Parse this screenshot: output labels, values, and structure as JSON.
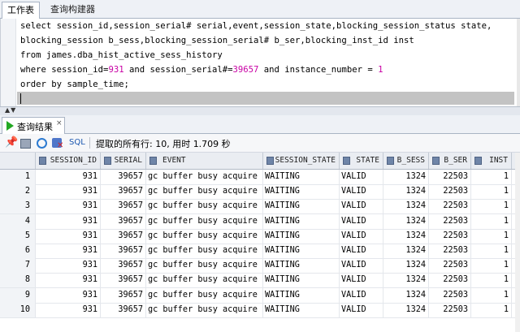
{
  "top_tabs": [
    "工作表",
    "查询构建器"
  ],
  "editor": {
    "lines": [
      "select session_id,session_serial# serial,event,session_state,blocking_session_status state,",
      "blocking_session b_sess,blocking_session_serial# b_ser,blocking_inst_id inst",
      "from james.dba_hist_active_sess_history",
      "where session_id=931 and session_serial#=39657 and instance_number = 1",
      "order by sample_time;"
    ]
  },
  "result_tab": {
    "label": "查询结果",
    "close": "×"
  },
  "toolbar": {
    "sql_label": "SQL",
    "status": "提取的所有行: 10, 用时 1.709 秒"
  },
  "table": {
    "columns": [
      "SESSION_ID",
      "SERIAL",
      "EVENT",
      "SESSION_STATE",
      "STATE",
      "B_SESS",
      "B_SER",
      "INST"
    ],
    "rows": [
      [
        "1",
        "931",
        "39657",
        "gc buffer busy acquire",
        "WAITING",
        "VALID",
        "1324",
        "22503",
        "1"
      ],
      [
        "2",
        "931",
        "39657",
        "gc buffer busy acquire",
        "WAITING",
        "VALID",
        "1324",
        "22503",
        "1"
      ],
      [
        "3",
        "931",
        "39657",
        "gc buffer busy acquire",
        "WAITING",
        "VALID",
        "1324",
        "22503",
        "1"
      ],
      [
        "4",
        "931",
        "39657",
        "gc buffer busy acquire",
        "WAITING",
        "VALID",
        "1324",
        "22503",
        "1"
      ],
      [
        "5",
        "931",
        "39657",
        "gc buffer busy acquire",
        "WAITING",
        "VALID",
        "1324",
        "22503",
        "1"
      ],
      [
        "6",
        "931",
        "39657",
        "gc buffer busy acquire",
        "WAITING",
        "VALID",
        "1324",
        "22503",
        "1"
      ],
      [
        "7",
        "931",
        "39657",
        "gc buffer busy acquire",
        "WAITING",
        "VALID",
        "1324",
        "22503",
        "1"
      ],
      [
        "8",
        "931",
        "39657",
        "gc buffer busy acquire",
        "WAITING",
        "VALID",
        "1324",
        "22503",
        "1"
      ],
      [
        "9",
        "931",
        "39657",
        "gc buffer busy acquire",
        "WAITING",
        "VALID",
        "1324",
        "22503",
        "1"
      ],
      [
        "10",
        "931",
        "39657",
        "gc buffer busy acquire",
        "WAITING",
        "VALID",
        "1324",
        "22503",
        "1"
      ]
    ]
  }
}
